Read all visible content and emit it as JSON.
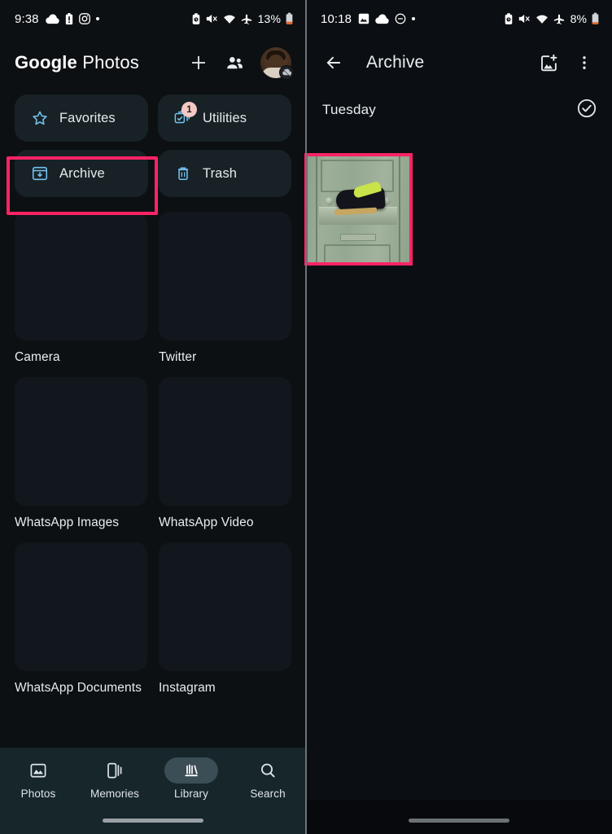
{
  "left_panel": {
    "status_bar": {
      "time": "9:38",
      "left_icons": [
        "cloud-icon",
        "battery-alert-icon",
        "instagram-icon",
        "dot-icon"
      ],
      "right_icons": [
        "alarm-icon",
        "mute-icon",
        "wifi-icon",
        "airplane-icon"
      ],
      "battery_percent": "13%"
    },
    "app_bar": {
      "brand_google": "Google",
      "brand_photos": " Photos",
      "add_label": "add-icon",
      "sharing_label": "sharing-icon",
      "avatar_label": "account-avatar",
      "avatar_badge": "backup-off-icon"
    },
    "chips": [
      {
        "label": "Favorites",
        "icon": "star-icon",
        "badge": null,
        "highlighted": false
      },
      {
        "label": "Utilities",
        "icon": "utilities-icon",
        "badge": "1",
        "highlighted": false
      },
      {
        "label": "Archive",
        "icon": "archive-icon",
        "badge": null,
        "highlighted": true
      },
      {
        "label": "Trash",
        "icon": "trash-icon",
        "badge": null,
        "highlighted": false
      }
    ],
    "albums": [
      {
        "name": "Camera"
      },
      {
        "name": "Twitter"
      },
      {
        "name": "WhatsApp Images"
      },
      {
        "name": "WhatsApp Video"
      },
      {
        "name": "WhatsApp Documents"
      },
      {
        "name": "Instagram"
      }
    ],
    "bottom_nav": [
      {
        "label": "Photos",
        "icon": "photos-icon",
        "active": false
      },
      {
        "label": "Memories",
        "icon": "memories-icon",
        "active": false
      },
      {
        "label": "Library",
        "icon": "library-icon",
        "active": true
      },
      {
        "label": "Search",
        "icon": "search-icon",
        "active": false
      }
    ]
  },
  "right_panel": {
    "status_bar": {
      "time": "10:18",
      "left_icons": [
        "photo-icon",
        "cloud-icon",
        "dnd-icon",
        "dot-icon"
      ],
      "right_icons": [
        "alarm-icon",
        "mute-icon",
        "wifi-icon",
        "airplane-icon"
      ],
      "battery_percent": "8%"
    },
    "app_bar": {
      "back_label": "back-arrow-icon",
      "title": "Archive",
      "add_photos_label": "add-photos-icon",
      "overflow_label": "more-options-icon"
    },
    "section": {
      "title": "Tuesday",
      "select_label": "select-all-check-icon"
    },
    "photo": {
      "alt": "dark shoe with yellow-green laces resting on a sage green door ledge",
      "highlighted": true
    }
  },
  "accent": {
    "highlight_pink": "#ff2366",
    "chip_bg": "#172126",
    "chip_icon_blue": "#74c2f0",
    "badge_bg": "#f3c9c4",
    "nav_bg": "#16262b",
    "nav_pill_active": "#3b4d55"
  }
}
